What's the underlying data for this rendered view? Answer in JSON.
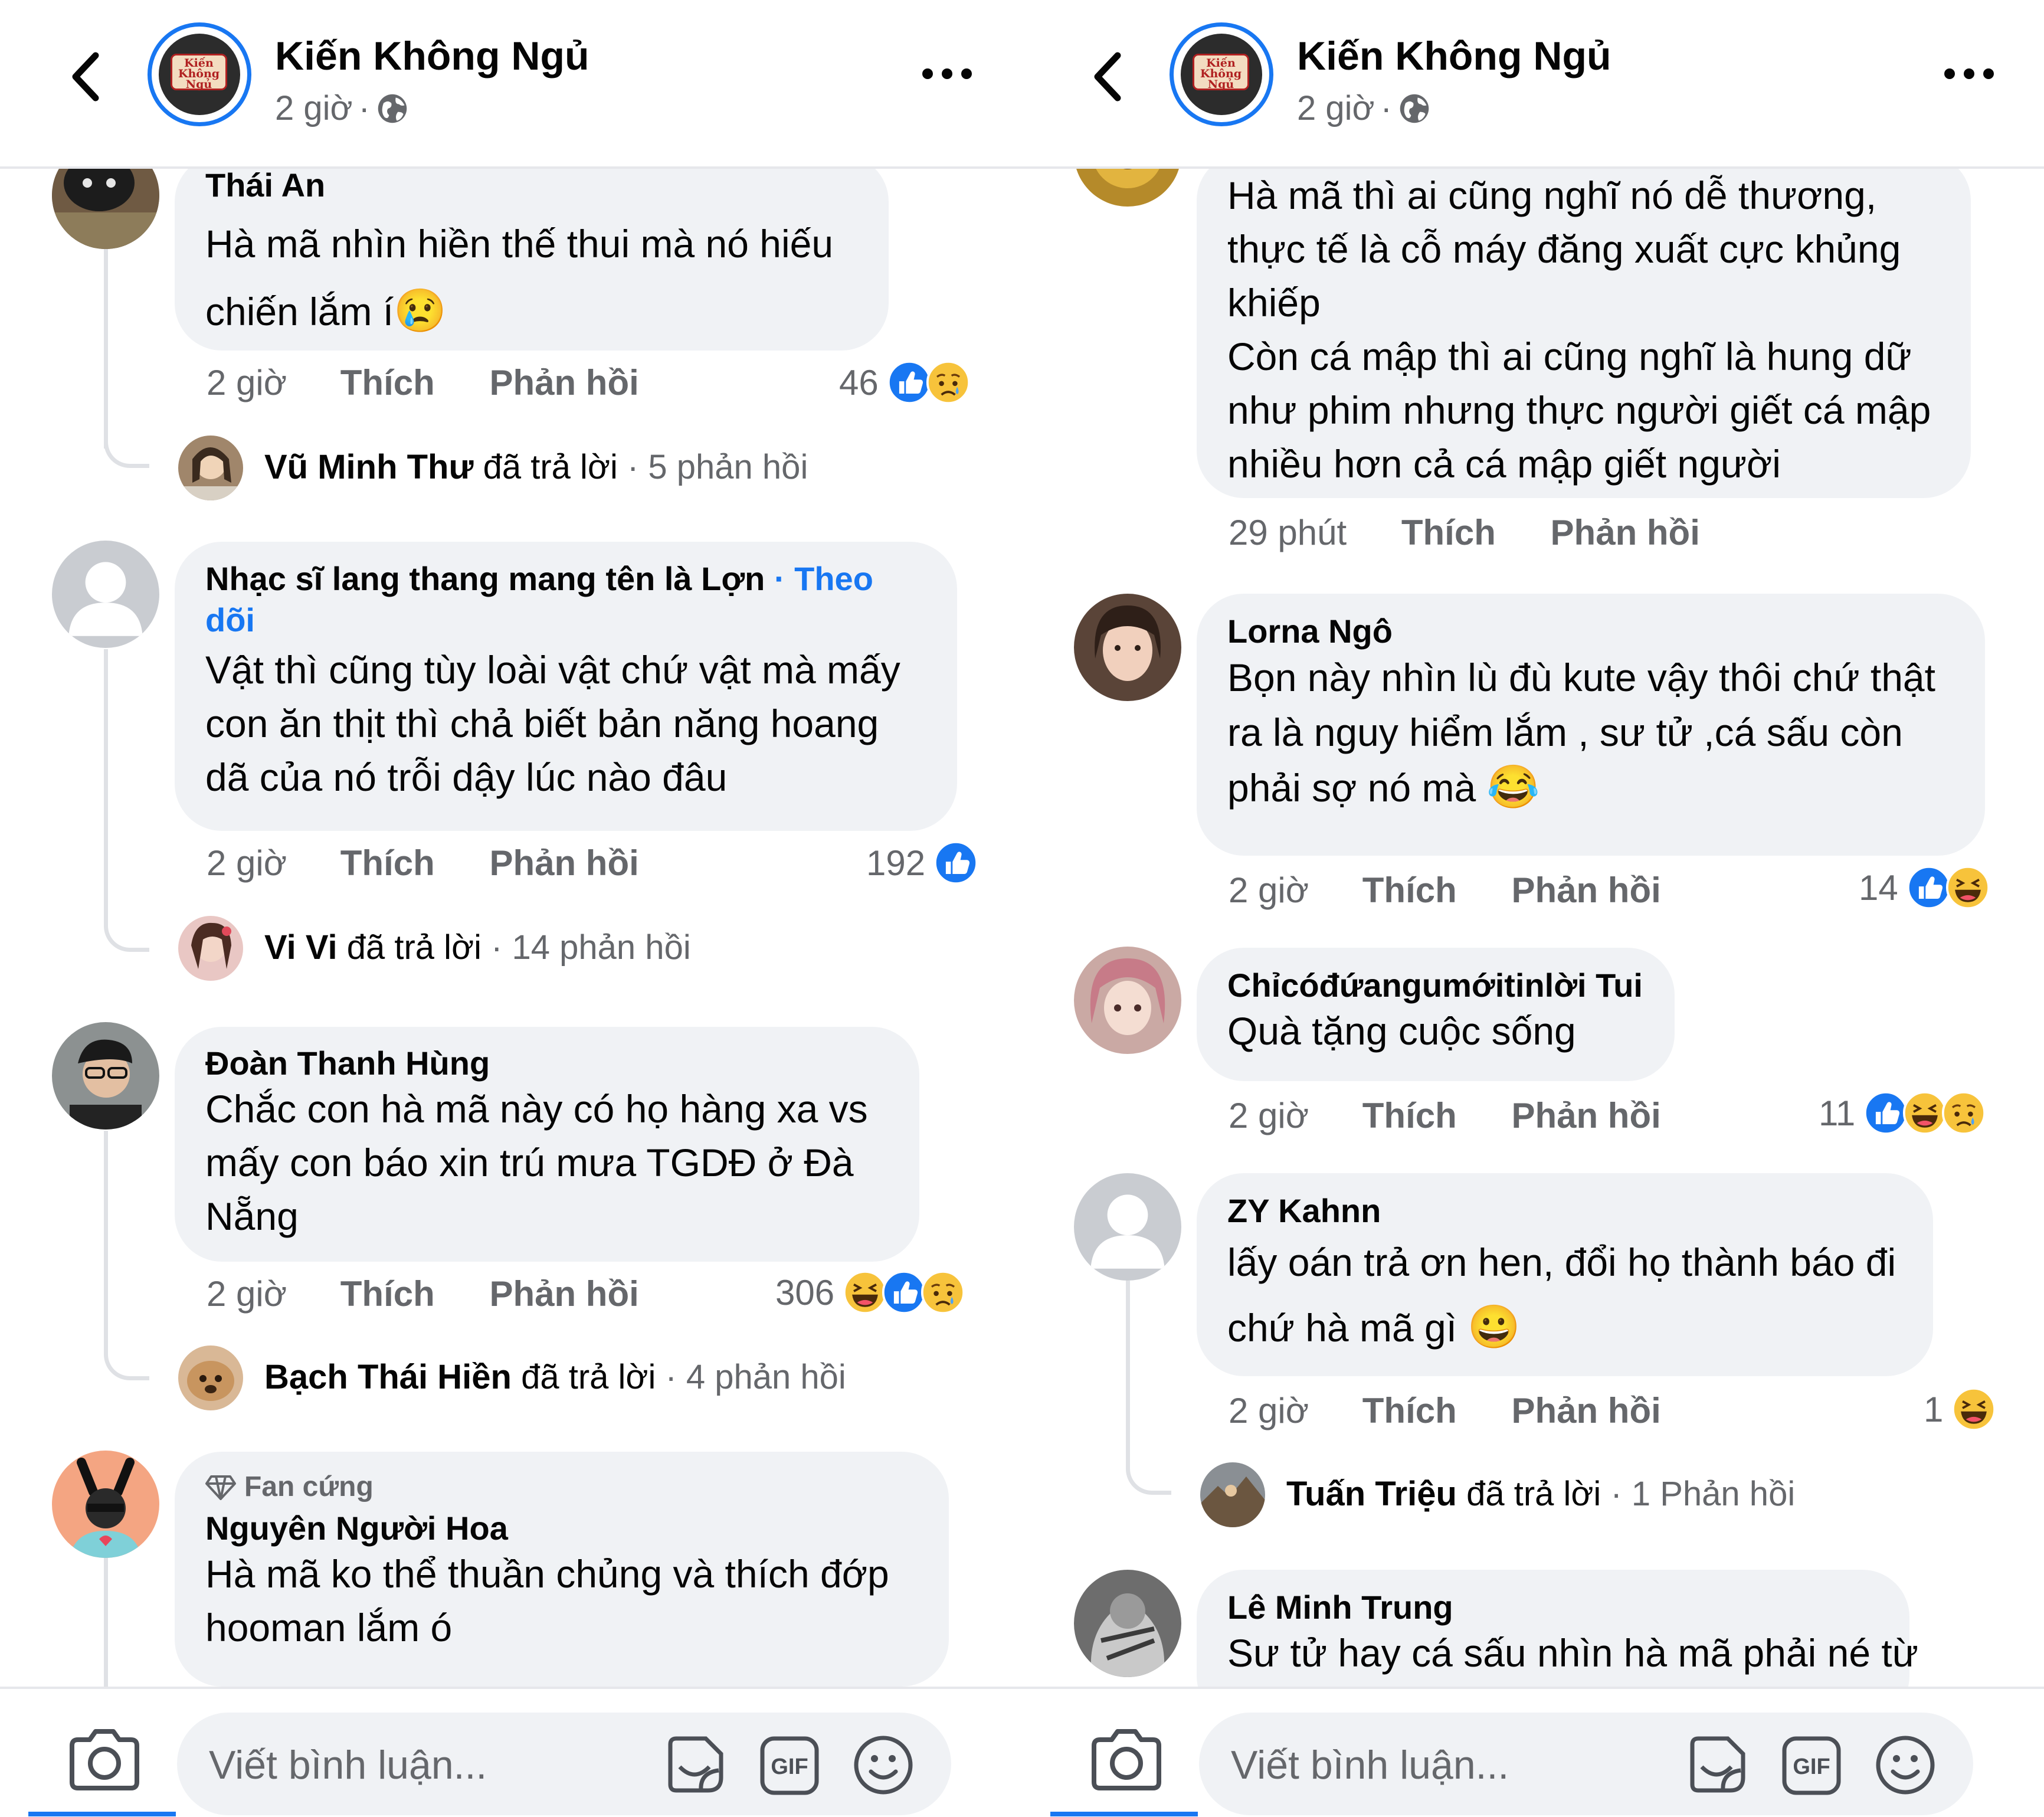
{
  "left": {
    "header": {
      "page_name": "Kiến Không Ngủ",
      "time": "2 giờ",
      "sep": "·",
      "logo_text": "Kiến Không Ngủ"
    },
    "comments": [
      {
        "name": "Thái An",
        "text": "Hà mã nhìn hiền thế thui mà nó hiếu chiến lắm í",
        "emoji": "😢",
        "time": "2 giờ",
        "like": "Thích",
        "reply": "Phản hồi",
        "count": "46",
        "reactions": [
          "like-reaction-icon",
          "sad-reaction-icon"
        ],
        "replies": {
          "name": "Vũ Minh Thư",
          "action": "đã trả lời",
          "count": "· 5 phản hồi"
        }
      },
      {
        "name": "Nhạc sĩ lang thang mang tên là Lợn",
        "follow": "· Theo dõi",
        "text": "Vật thì cũng tùy loài vật chứ vật mà mấy con ăn thịt thì chả biết bản năng hoang dã của nó trỗi dậy lúc nào đâu",
        "time": "2 giờ",
        "like": "Thích",
        "reply": "Phản hồi",
        "count": "192",
        "reactions": [
          "like-reaction-icon"
        ],
        "replies": {
          "name": "Vi Vi",
          "action": "đã trả lời",
          "count": "· 14 phản hồi"
        }
      },
      {
        "name": "Đoàn Thanh Hùng",
        "text": "Chắc con hà mã này có họ hàng xa vs mấy con báo xin trú mưa TGDĐ ở Đà Nẵng",
        "time": "2 giờ",
        "like": "Thích",
        "reply": "Phản hồi",
        "count": "306",
        "reactions": [
          "haha-reaction-icon",
          "like-reaction-icon",
          "sad-reaction-icon"
        ],
        "replies": {
          "name": "Bạch Thái Hiền",
          "action": "đã trả lời",
          "count": "· 4 phản hồi"
        }
      },
      {
        "badge": "Fan cứng",
        "name": "Nguyên Người Hoa",
        "text": "Hà mã ko thể thuần chủng và thích đớp hooman lắm ó"
      }
    ],
    "footer": {
      "placeholder": "Viết bình luận...",
      "gif": "GIF"
    }
  },
  "right": {
    "header": {
      "page_name": "Kiến Không Ngủ",
      "time": "2 giờ",
      "sep": "·",
      "logo_text": "Kiến Không Ngủ"
    },
    "comments": [
      {
        "text": "Hà mã thì ai cũng nghĩ nó dễ thương, thực tế là cỗ máy đăng xuất cực khủng khiếp\nCòn cá mập thì ai cũng nghĩ là hung dữ như phim nhưng thực người giết cá mập nhiều hơn cả cá mập giết người",
        "time": "29 phút",
        "like": "Thích",
        "reply": "Phản hồi"
      },
      {
        "name": "Lorna Ngô",
        "text": "Bọn này nhìn lù đù kute vậy thôi chứ thật ra là nguy hiểm lắm , sư tử ,cá sấu còn phải sợ nó mà",
        "emoji": "😂",
        "time": "2 giờ",
        "like": "Thích",
        "reply": "Phản hồi",
        "count": "14",
        "reactions": [
          "like-reaction-icon",
          "haha-reaction-icon"
        ]
      },
      {
        "name": "Chỉcóđứangumớitinlời Tui",
        "text": "Quà tặng cuộc sống",
        "time": "2 giờ",
        "like": "Thích",
        "reply": "Phản hồi",
        "count": "11",
        "reactions": [
          "like-reaction-icon",
          "haha-reaction-icon",
          "sad-reaction-icon"
        ]
      },
      {
        "name": "ZY Kahnn",
        "text": "lấy oán trả ơn hen, đổi họ thành báo đi chứ hà mã gì",
        "emoji": "😀",
        "time": "2 giờ",
        "like": "Thích",
        "reply": "Phản hồi",
        "count": "1",
        "reactions": [
          "haha-reaction-icon"
        ],
        "replies": {
          "name": "Tuấn Triệu",
          "action": "đã trả lời",
          "count": "· 1 Phản hồi"
        }
      },
      {
        "name": "Lê Minh Trung",
        "text": "Sư tử hay cá sấu nhìn hà mã phải né từ"
      }
    ],
    "footer": {
      "placeholder": "Viết bình luận...",
      "gif": "GIF"
    }
  },
  "colors": {
    "accent": "#1877f2",
    "bubble": "#f0f2f5",
    "muted": "#65676b",
    "line": "#dfe1e5"
  }
}
